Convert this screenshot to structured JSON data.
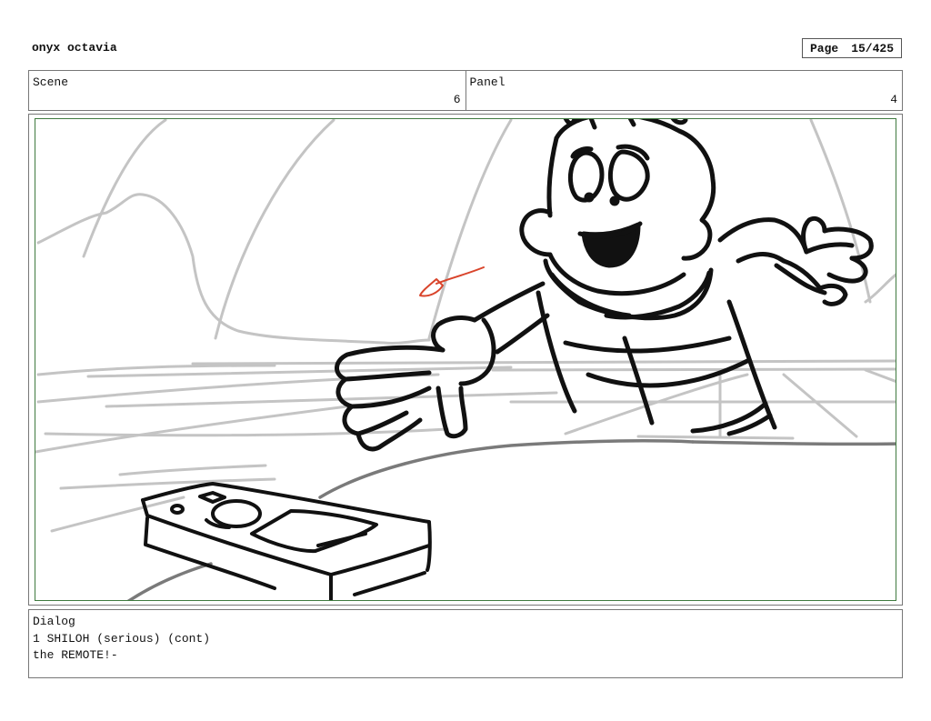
{
  "header": {
    "project_title": "onyx octavia",
    "page_label": "Page",
    "page_number": "15/425"
  },
  "scene": {
    "label": "Scene",
    "value": "6"
  },
  "panel": {
    "label": "Panel",
    "value": "4"
  },
  "dialog": {
    "label": "Dialog",
    "line_1": "1 SHILOH (serious) (cont)",
    "line_2": "the REMOTE!-"
  },
  "colors": {
    "frame_border": "#3f7a3f",
    "sketch_ink": "#111111",
    "background_sketch": "#c4c4c4",
    "accent_red": "#d9442b"
  }
}
